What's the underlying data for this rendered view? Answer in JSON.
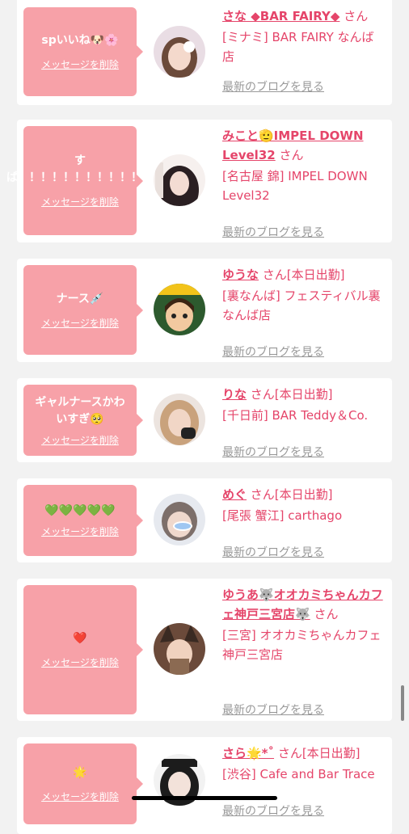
{
  "cards": [
    {
      "message": "spいいね🐶🌸",
      "delete_label": "メッセージを削除",
      "name": "さな ◆BAR FAIRY◆",
      "san": "さん",
      "shop": "[ミナミ] BAR FAIRY なんば店",
      "blog": "最新のブログを見る"
    },
    {
      "message": "すぱ！！！！！！！！！！！！",
      "delete_label": "メッセージを削除",
      "name": "みこと🫡IMPEL DOWN Level32",
      "san": "さん",
      "shop": "[名古屋 錦] IMPEL DOWN Level32",
      "blog": "最新のブログを見る"
    },
    {
      "message": "ナース💉",
      "delete_label": "メッセージを削除",
      "name": "ゆうな",
      "san": "さん[本日出勤]",
      "shop": "[裏なんば] フェスティバル裏なんば店",
      "blog": "最新のブログを見る"
    },
    {
      "message": "ギャルナースかわいすぎ🥺",
      "delete_label": "メッセージを削除",
      "name": "りな",
      "san": "さん[本日出勤]",
      "shop": "[千日前] BAR Teddy＆Co.",
      "blog": "最新のブログを見る"
    },
    {
      "message": "💚💚💚💚💚",
      "delete_label": "メッセージを削除",
      "name": "めぐ",
      "san": "さん[本日出勤]",
      "shop": "[尾張 蟹江] carthago",
      "blog": "最新のブログを見る"
    },
    {
      "message": "❤️",
      "delete_label": "メッセージを削除",
      "name": "ゆうあ🐺オオカミちゃんカフェ神戸三宮店🐺",
      "san": "さん",
      "shop": "[三宮] オオカミちゃんカフェ神戸三宮店",
      "blog": "最新のブログを見る"
    },
    {
      "message": "🌟",
      "delete_label": "メッセージを削除",
      "name": "さら🌟*˚",
      "san": "さん[本日出勤]",
      "shop": "[渋谷] Cafe and Bar Trace",
      "blog": "最新のブログを見る"
    }
  ]
}
